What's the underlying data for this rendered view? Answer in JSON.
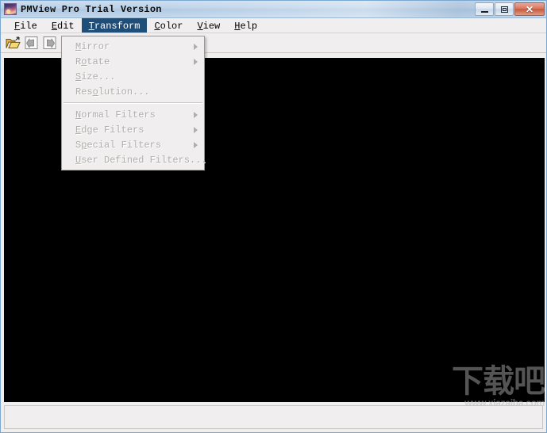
{
  "window": {
    "title": "PMView Pro Trial Version",
    "icon": "app-image-icon",
    "controls": {
      "minimize_label": "–",
      "maximize_label": "□",
      "close_label": "✕"
    }
  },
  "menubar": {
    "items": [
      {
        "label": "File",
        "mnemonic": "F",
        "active": false
      },
      {
        "label": "Edit",
        "mnemonic": "E",
        "active": false
      },
      {
        "label": "Transform",
        "mnemonic": "T",
        "active": true
      },
      {
        "label": "Color",
        "mnemonic": "C",
        "active": false
      },
      {
        "label": "View",
        "mnemonic": "V",
        "active": false
      },
      {
        "label": "Help",
        "mnemonic": "H",
        "active": false
      }
    ]
  },
  "toolbar": {
    "buttons": [
      {
        "name": "open-file-button",
        "icon": "open-folder-icon",
        "enabled": true
      },
      {
        "name": "back-button",
        "icon": "left-arrow-icon",
        "enabled": false
      },
      {
        "name": "forward-button",
        "icon": "right-arrow-icon",
        "enabled": false
      },
      {
        "name": "page-button",
        "icon": "page-icon",
        "enabled": false
      },
      {
        "name": "thumbnail-button",
        "icon": "filmstrip-icon",
        "enabled": false
      },
      {
        "name": "properties-button",
        "icon": "properties-icon",
        "enabled": true
      },
      {
        "name": "help-button",
        "icon": "question-mark-icon",
        "enabled": true
      }
    ]
  },
  "transform_menu": {
    "title": "Transform",
    "items": [
      {
        "label": "Mirror",
        "mnemonic_index": 0,
        "enabled": false,
        "submenu": true,
        "separator_after": false
      },
      {
        "label": "Rotate",
        "mnemonic_index": 1,
        "enabled": false,
        "submenu": true,
        "separator_after": false
      },
      {
        "label": "Size...",
        "mnemonic_index": 0,
        "enabled": false,
        "submenu": false,
        "separator_after": false
      },
      {
        "label": "Resolution...",
        "mnemonic_index": 3,
        "enabled": false,
        "submenu": false,
        "separator_after": true
      },
      {
        "label": "Normal Filters",
        "mnemonic_index": 0,
        "enabled": false,
        "submenu": true,
        "separator_after": false
      },
      {
        "label": "Edge Filters",
        "mnemonic_index": 0,
        "enabled": false,
        "submenu": true,
        "separator_after": false
      },
      {
        "label": "Special Filters",
        "mnemonic_index": 1,
        "enabled": false,
        "submenu": true,
        "separator_after": false
      },
      {
        "label": "User Defined Filters...",
        "mnemonic_index": 0,
        "enabled": false,
        "submenu": false,
        "separator_after": false
      }
    ]
  },
  "canvas": {
    "background_color": "#000000"
  },
  "watermark": {
    "text_cn": "下载吧",
    "url": "www.xiazaiba.com"
  },
  "status_bar": {
    "text": ""
  },
  "colors": {
    "titlebar_blue": "#bcd2e8",
    "menu_highlight": "#1f4e79",
    "disabled_text": "#b0aeab",
    "chrome_bg": "#f0eeee",
    "close_red": "#c35a40",
    "canvas_black": "#000000"
  }
}
